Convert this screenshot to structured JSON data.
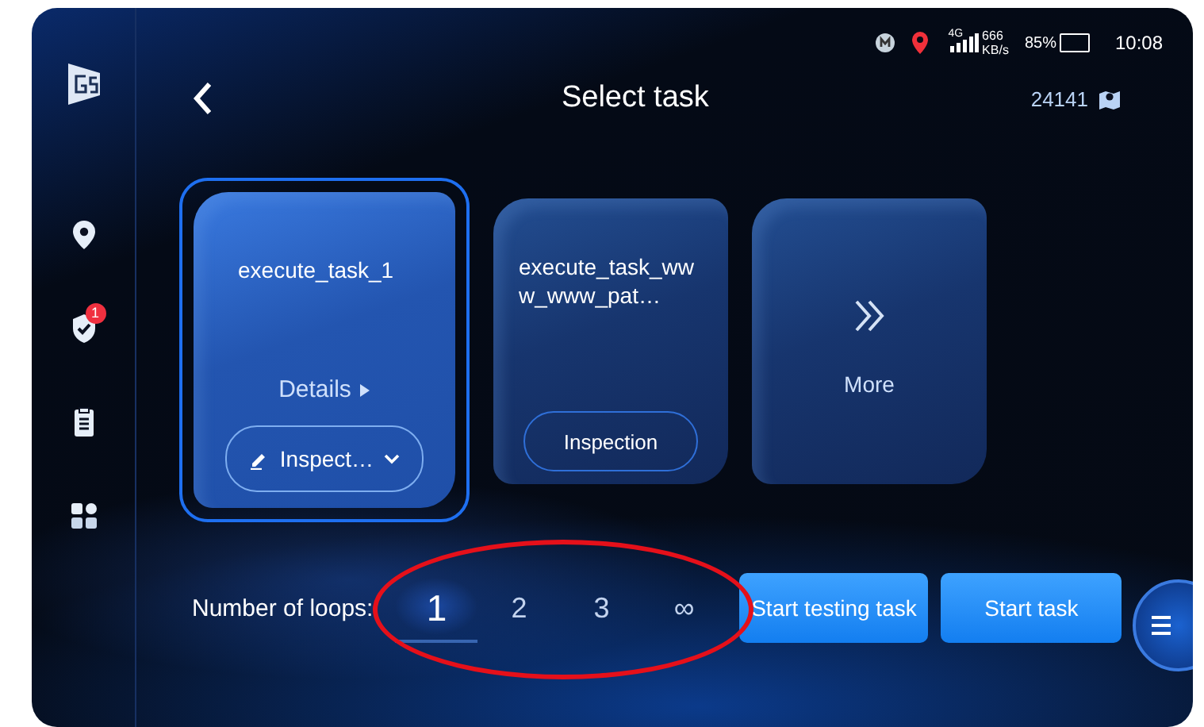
{
  "status_bar": {
    "network": "4G",
    "speed": "666",
    "speed_unit": "KB/s",
    "battery": "85%",
    "time": "10:08"
  },
  "sidebar": {
    "items": [
      {
        "kind": "location",
        "selected": false
      },
      {
        "kind": "shield",
        "selected": false,
        "badge": "1"
      },
      {
        "kind": "clipboard",
        "selected": false
      },
      {
        "kind": "apps",
        "selected": false
      }
    ]
  },
  "header": {
    "title": "Select task",
    "count": "24141"
  },
  "tasks": [
    {
      "kind": "task",
      "name": "execute_task_1",
      "selected": true,
      "details": "Details",
      "type": "Inspect…",
      "editable": true
    },
    {
      "kind": "task",
      "name": "execute_task_www_www_pat…",
      "selected": false,
      "type": "Inspection",
      "editable": false
    },
    {
      "kind": "more",
      "label": "More",
      "selected": false
    }
  ],
  "loops": {
    "label": "Number of loops:",
    "options": [
      {
        "label": "1",
        "selected": true
      },
      {
        "label": "2",
        "selected": false
      },
      {
        "label": "3",
        "selected": false
      },
      {
        "label": "∞",
        "selected": false
      }
    ]
  },
  "buttons": [
    "Start testing task",
    "Start task"
  ],
  "annotation": {
    "kind": "ellipse"
  }
}
